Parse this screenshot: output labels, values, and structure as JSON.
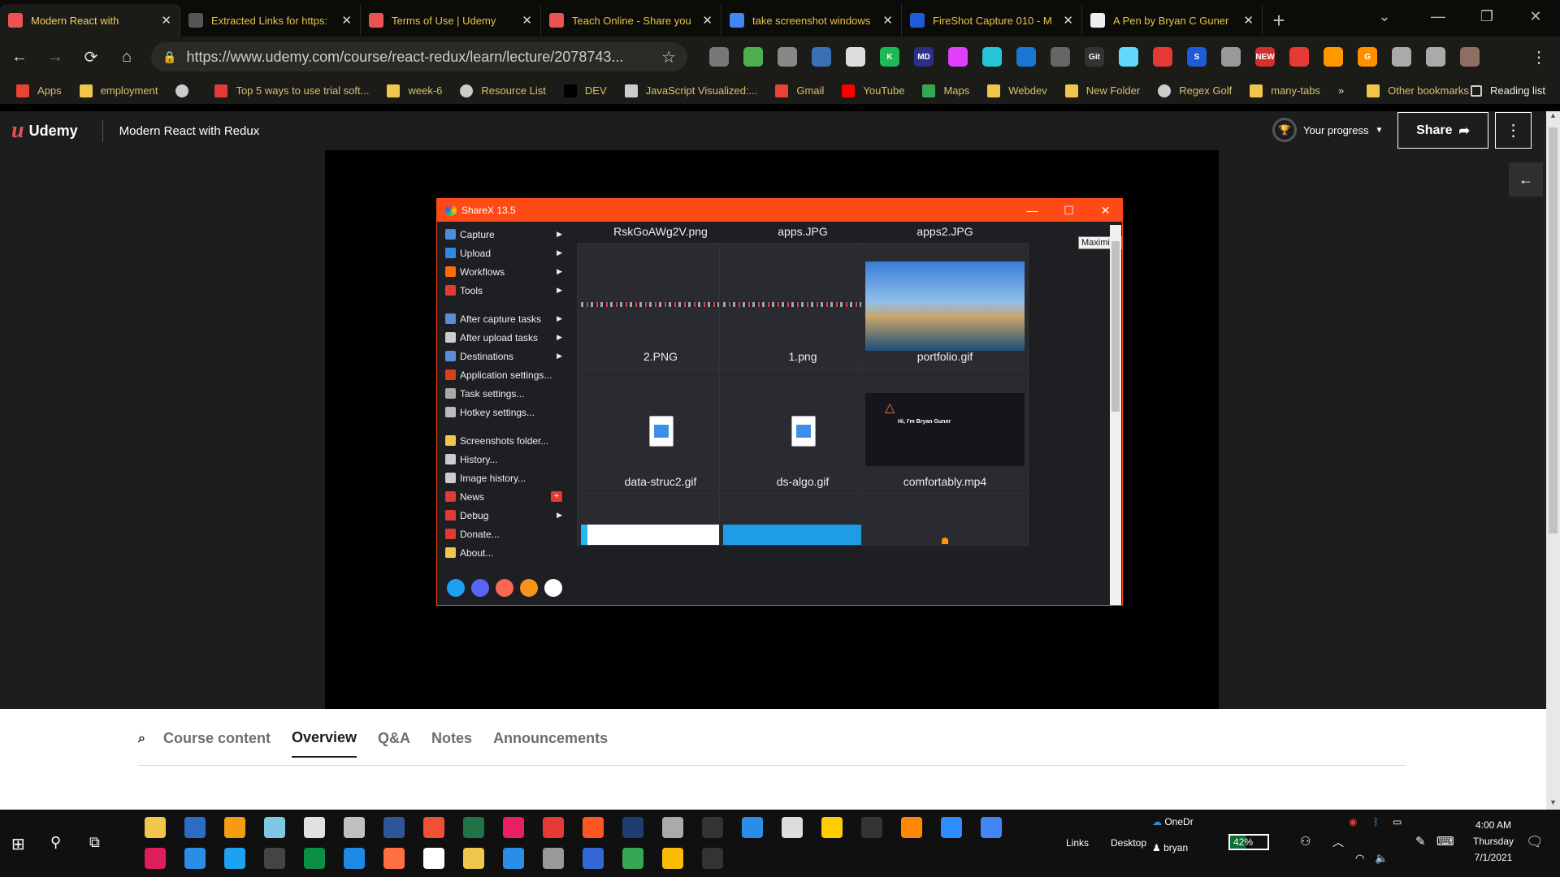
{
  "chrome": {
    "tabs": [
      {
        "title": "Modern React with",
        "icon_color": "#ec5252",
        "active": true
      },
      {
        "title": "Extracted Links for https:",
        "icon_color": "#555555"
      },
      {
        "title": "Terms of Use | Udemy",
        "icon_color": "#ec5252"
      },
      {
        "title": "Teach Online - Share you",
        "icon_color": "#ec5252"
      },
      {
        "title": "take screenshot windows",
        "icon_color": "#4285f4"
      },
      {
        "title": "FireShot Capture 010 - M",
        "icon_color": "#1e5bd8"
      },
      {
        "title": "A Pen by Bryan C Guner",
        "icon_color": "#eeeeee"
      }
    ],
    "url": "https://www.udemy.com/course/react-redux/learn/lecture/2078743...",
    "extensions": [
      {
        "name": "camera-ext-icon",
        "color": "#777777",
        "text": ""
      },
      {
        "name": "grid-ext-icon",
        "color": "#4caf50",
        "text": ""
      },
      {
        "name": "cube-ext-icon",
        "color": "#888888",
        "text": ""
      },
      {
        "name": "card-ext-icon",
        "color": "#3b6fb6",
        "text": ""
      },
      {
        "name": "gear-ext-icon",
        "color": "#dddddd",
        "text": ""
      },
      {
        "name": "k-ext-icon",
        "color": "#1db954",
        "text": "K"
      },
      {
        "name": "md-ext-icon",
        "color": "#2c2f88",
        "text": "MD"
      },
      {
        "name": "color-ext-icon",
        "color": "#e040fb",
        "text": ""
      },
      {
        "name": "wave-ext-icon",
        "color": "#26c6da",
        "text": ""
      },
      {
        "name": "box-ext-icon",
        "color": "#1976d2",
        "text": ""
      },
      {
        "name": "dark-ext-icon",
        "color": "#666666",
        "text": ""
      },
      {
        "name": "gitzip-ext-icon",
        "color": "#333333",
        "text": "Git"
      },
      {
        "name": "react-ext-icon",
        "color": "#61dafb",
        "text": ""
      },
      {
        "name": "circle-ext-icon",
        "color": "#e53935",
        "text": ""
      },
      {
        "name": "s-ext-icon",
        "color": "#1e5bd8",
        "text": "S"
      },
      {
        "name": "target-ext-icon",
        "color": "#999999",
        "text": ""
      },
      {
        "name": "new-ext-icon",
        "color": "#d32f2f",
        "text": "NEW"
      },
      {
        "name": "pokeball-ext-icon",
        "color": "#e53935",
        "text": ""
      },
      {
        "name": "firefox-ext-icon",
        "color": "#ff9800",
        "text": ""
      },
      {
        "name": "g-ext-icon",
        "color": "#ff8f00",
        "text": "G"
      },
      {
        "name": "puzzle-ext-icon",
        "color": "#aaaaaa",
        "text": ""
      },
      {
        "name": "list-ext-icon",
        "color": "#aaaaaa",
        "text": ""
      },
      {
        "name": "profile-avatar",
        "color": "#8d6e63",
        "text": ""
      }
    ]
  },
  "bookmarks": [
    {
      "label": "Apps",
      "icon": "apps-grid-icon",
      "color": "#ea4335"
    },
    {
      "label": "employment",
      "icon": "folder-icon",
      "color": "#f0c74a"
    },
    {
      "label": "",
      "icon": "globe-icon",
      "color": "#cccccc"
    },
    {
      "label": "Top 5 ways to use trial soft...",
      "icon": "s-icon",
      "color": "#e53935"
    },
    {
      "label": "week-6",
      "icon": "folder-icon",
      "color": "#f0c74a"
    },
    {
      "label": "Resource List",
      "icon": "globe-icon",
      "color": "#cccccc"
    },
    {
      "label": "DEV",
      "icon": "dev-icon",
      "color": "#000000"
    },
    {
      "label": "JavaScript Visualized:...",
      "icon": "sparkle-icon",
      "color": "#cccccc"
    },
    {
      "label": "Gmail",
      "icon": "gmail-icon",
      "color": "#ea4335"
    },
    {
      "label": "YouTube",
      "icon": "youtube-icon",
      "color": "#ff0000"
    },
    {
      "label": "Maps",
      "icon": "maps-icon",
      "color": "#34a853"
    },
    {
      "label": "Webdev",
      "icon": "folder-icon",
      "color": "#f0c74a"
    },
    {
      "label": "New Folder",
      "icon": "folder-icon",
      "color": "#f0c74a"
    },
    {
      "label": "Regex Golf",
      "icon": "globe-icon",
      "color": "#cccccc"
    },
    {
      "label": "many-tabs",
      "icon": "folder-icon",
      "color": "#f0c74a"
    }
  ],
  "bookmarks_more": "»",
  "bookmarks_other": "Other bookmarks",
  "reading_list": "Reading list",
  "udemy": {
    "logo": "Udemy",
    "logo_letter": "u",
    "course_title": "Modern React with Redux",
    "progress_label": "Your progress",
    "share_label": "Share",
    "share_arrow": "➦",
    "more": "⋮",
    "sidebar_toggle": "←",
    "tabs": [
      "Course content",
      "Overview",
      "Q&A",
      "Notes",
      "Announcements"
    ],
    "selected_tab": "Overview"
  },
  "sharex": {
    "title": "ShareX 13.5",
    "tooltip": "Maximize",
    "menu": [
      {
        "label": "Capture",
        "arrow": true,
        "color": "#4a90d9"
      },
      {
        "label": "Upload",
        "arrow": true,
        "color": "#2f8ae5"
      },
      {
        "label": "Workflows",
        "arrow": true,
        "color": "#ff6b00"
      },
      {
        "label": "Tools",
        "arrow": true,
        "color": "#e53935"
      },
      {
        "gap": true
      },
      {
        "label": "After capture tasks",
        "arrow": true,
        "color": "#5c8dd6"
      },
      {
        "label": "After upload tasks",
        "arrow": true,
        "color": "#cccccc"
      },
      {
        "label": "Destinations",
        "arrow": true,
        "color": "#5c8dd6"
      },
      {
        "label": "Application settings...",
        "arrow": false,
        "color": "#d84315"
      },
      {
        "label": "Task settings...",
        "arrow": false,
        "color": "#aaaaaa"
      },
      {
        "label": "Hotkey settings...",
        "arrow": false,
        "color": "#bbbbbb"
      },
      {
        "gap": true
      },
      {
        "label": "Screenshots folder...",
        "arrow": false,
        "color": "#f0c74a"
      },
      {
        "label": "History...",
        "arrow": false,
        "color": "#cccccc"
      },
      {
        "label": "Image history...",
        "arrow": false,
        "color": "#cccccc"
      },
      {
        "label": "News",
        "arrow": false,
        "badge": "+",
        "color": "#e53935"
      },
      {
        "label": "Debug",
        "arrow": true,
        "color": "#e53935"
      },
      {
        "label": "Donate...",
        "arrow": false,
        "color": "#e53935"
      },
      {
        "label": "About...",
        "arrow": false,
        "color": "#f0c74a"
      }
    ],
    "social": [
      {
        "name": "twitter-icon",
        "color": "#1da1f2"
      },
      {
        "name": "discord-icon",
        "color": "#5865f2"
      },
      {
        "name": "patreon-icon",
        "color": "#f96854"
      },
      {
        "name": "bitcoin-icon",
        "color": "#f7931a"
      },
      {
        "name": "github-icon",
        "color": "#ffffff"
      }
    ],
    "files": [
      {
        "name": "RskGoAWg2V.png",
        "kind": "strip"
      },
      {
        "name": "apps.JPG",
        "kind": "strip"
      },
      {
        "name": "apps2.JPG",
        "kind": "landscape"
      },
      {
        "name": "2.PNG",
        "kind": "fileicon"
      },
      {
        "name": "1.png",
        "kind": "fileicon"
      },
      {
        "name": "portfolio.gif",
        "kind": "portfolio",
        "caption": "Hi, I'm Bryan Guner"
      },
      {
        "name": "data-struc2.gif",
        "kind": "bluepage"
      },
      {
        "name": "ds-algo.gif",
        "kind": "bluebar"
      },
      {
        "name": "comfortably.mp4",
        "kind": "dark"
      }
    ]
  },
  "taskbar": {
    "tray": {
      "links": "Links",
      "desktop": "Desktop",
      "onedrive": "OneDr",
      "user": "bryan",
      "battery": "42%",
      "time": "4:00 AM",
      "day": "Thursday",
      "date": "7/1/2021"
    }
  }
}
